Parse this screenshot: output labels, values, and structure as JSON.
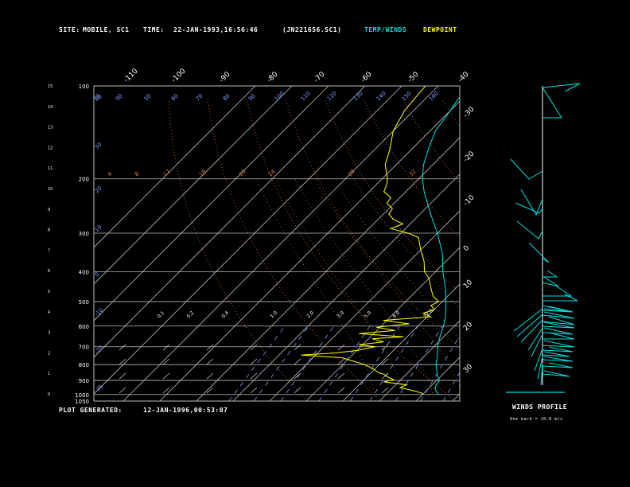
{
  "header": {
    "site_label": "SITE:",
    "site_value": "MOBILE, SC1",
    "time_label": "TIME:",
    "time_value": "22-JAN-1993,16:56:46",
    "file_id": "(JN221656.SC1)",
    "legend_temp": "TEMP/WINDS",
    "legend_dew": "DEWPOINT"
  },
  "footer": {
    "plot_label": "PLOT GENERATED:",
    "plot_value": "12-JAN-1996,00:53:07",
    "winds_title": "WINDS PROFILE",
    "winds_note": "One barb = 10.0 m/s"
  },
  "colors": {
    "background": "#000000",
    "grid": "#bbbbbb",
    "temp": "#00e0e0",
    "dewpoint": "#ffff00",
    "dry_adiabat": "#e08040",
    "moist_adiabat": "#e08040",
    "mixing_ratio": "#80a0ff",
    "text": "#ffffff"
  },
  "chart_data": {
    "type": "line",
    "subtype": "skew-T log-P",
    "pressure_ticks": [
      "100",
      "200",
      "300",
      "400",
      "500",
      "600",
      "700",
      "800",
      "900",
      "1000",
      "1050"
    ],
    "height_ticks": [
      "0",
      "1",
      "2",
      "3",
      "4",
      "5",
      "6",
      "7",
      "8",
      "9",
      "10",
      "11",
      "12",
      "13",
      "14",
      "15"
    ],
    "isotherm_labels_top": [
      "-110",
      "-100",
      "-90",
      "-80",
      "-70",
      "-60",
      "-50",
      "-40"
    ],
    "isotherm_labels_right": [
      "-30",
      "-20",
      "-10",
      "0",
      "10",
      "20",
      "30"
    ],
    "theta_labels": [
      "100",
      "90",
      "80",
      "70",
      "100",
      "110",
      "120",
      "130",
      "140",
      "150",
      "160"
    ],
    "theta_labels_left": [
      "70",
      "50"
    ],
    "mixing_ratio_labels": [
      "0.1",
      "0.2",
      "0.4",
      "1.0",
      "2.0",
      "3.0",
      "5.0",
      "8.0",
      "12.0",
      "20.0"
    ],
    "theta_e_labels": [
      "4",
      "8",
      "12",
      "16",
      "20",
      "24",
      "28",
      "32"
    ],
    "wind_barb_labels": [
      "40",
      "30",
      "20",
      "10",
      "0",
      "-10",
      "-20"
    ],
    "series": [
      {
        "name": "TEMP/WINDS",
        "points": [
          [
            1000,
            14.5
          ],
          [
            980,
            13.0
          ],
          [
            950,
            11.5
          ],
          [
            920,
            11.0
          ],
          [
            900,
            10.8
          ],
          [
            870,
            9.0
          ],
          [
            850,
            8.0
          ],
          [
            800,
            5.5
          ],
          [
            750,
            3.5
          ],
          [
            700,
            1.0
          ],
          [
            650,
            -1.0
          ],
          [
            600,
            -3.0
          ],
          [
            560,
            -5.0
          ],
          [
            500,
            -9.0
          ],
          [
            450,
            -13.0
          ],
          [
            400,
            -18.0
          ],
          [
            350,
            -23.0
          ],
          [
            300,
            -30.0
          ],
          [
            280,
            -33.5
          ],
          [
            250,
            -39.0
          ],
          [
            220,
            -45.0
          ],
          [
            200,
            -49.0
          ],
          [
            180,
            -52.5
          ],
          [
            160,
            -55.5
          ],
          [
            140,
            -58.5
          ],
          [
            120,
            -60.0
          ],
          [
            110,
            -61.0
          ],
          [
            100,
            -61.5
          ]
        ]
      },
      {
        "name": "DEWPOINT",
        "points": [
          [
            1000,
            10.0
          ],
          [
            990,
            9.5
          ],
          [
            975,
            7.0
          ],
          [
            950,
            2.0
          ],
          [
            930,
            3.0
          ],
          [
            910,
            -4.0
          ],
          [
            895,
            -2.0
          ],
          [
            880,
            -4.0
          ],
          [
            860,
            -6.0
          ],
          [
            850,
            -8.0
          ],
          [
            830,
            -10.0
          ],
          [
            800,
            -14.0
          ],
          [
            780,
            -18.0
          ],
          [
            760,
            -22.0
          ],
          [
            745,
            -34.0
          ],
          [
            735,
            -26.0
          ],
          [
            720,
            -20.0
          ],
          [
            700,
            -16.0
          ],
          [
            690,
            -21.0
          ],
          [
            675,
            -15.0
          ],
          [
            660,
            -19.0
          ],
          [
            650,
            -11.0
          ],
          [
            635,
            -24.0
          ],
          [
            620,
            -15.0
          ],
          [
            605,
            -21.0
          ],
          [
            590,
            -13.0
          ],
          [
            575,
            -21.0
          ],
          [
            560,
            -9.0
          ],
          [
            545,
            -12.0
          ],
          [
            530,
            -10.0
          ],
          [
            515,
            -12.0
          ],
          [
            500,
            -11.0
          ],
          [
            480,
            -14.0
          ],
          [
            450,
            -17.0
          ],
          [
            420,
            -20.0
          ],
          [
            400,
            -23.0
          ],
          [
            370,
            -26.0
          ],
          [
            340,
            -30.0
          ],
          [
            310,
            -34.0
          ],
          [
            300,
            -38.0
          ],
          [
            290,
            -44.0
          ],
          [
            280,
            -42.0
          ],
          [
            270,
            -46.0
          ],
          [
            260,
            -48.5
          ],
          [
            250,
            -49.0
          ],
          [
            240,
            -52.0
          ],
          [
            230,
            -52.5
          ],
          [
            220,
            -56.0
          ],
          [
            210,
            -57.0
          ],
          [
            200,
            -58.5
          ],
          [
            180,
            -63.0
          ],
          [
            160,
            -66.0
          ],
          [
            140,
            -70.0
          ],
          [
            120,
            -72.5
          ],
          [
            110,
            -73.0
          ],
          [
            100,
            -73.5
          ]
        ]
      }
    ],
    "xlim": [
      -40,
      40
    ],
    "ylim": [
      1050,
      100
    ],
    "y_scale": "log",
    "grid": true
  }
}
